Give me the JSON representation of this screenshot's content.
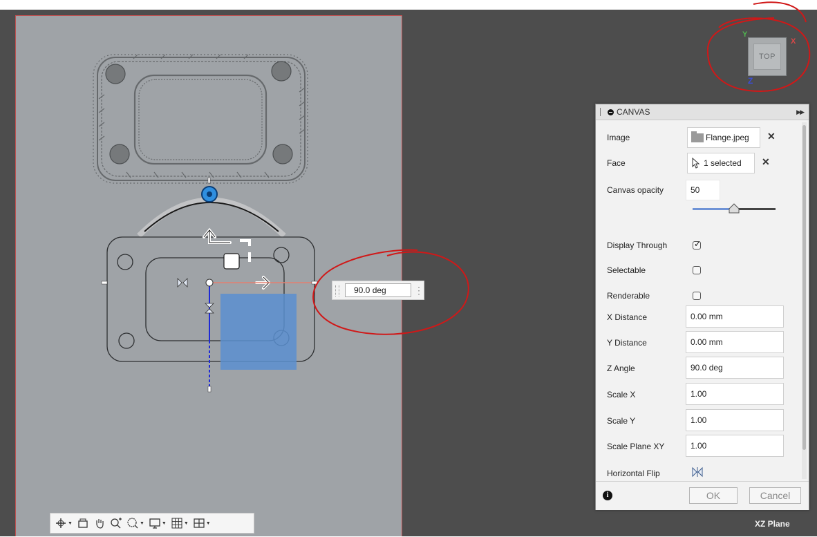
{
  "viewcube": {
    "face_label": "TOP",
    "axis_y": "Y",
    "axis_x": "X",
    "axis_z": "Z"
  },
  "angle_input": {
    "value": "90.0 deg"
  },
  "panel": {
    "title": "CANVAS",
    "image": {
      "label": "Image",
      "value": "Flange.jpeg"
    },
    "face": {
      "label": "Face",
      "value": "1 selected"
    },
    "opacity": {
      "label": "Canvas opacity",
      "value": "50",
      "slider_fraction": 0.5
    },
    "display_through": {
      "label": "Display Through",
      "checked": true
    },
    "selectable": {
      "label": "Selectable",
      "checked": false
    },
    "renderable": {
      "label": "Renderable",
      "checked": false
    },
    "x_distance": {
      "label": "X Distance",
      "value": "0.00 mm"
    },
    "y_distance": {
      "label": "Y Distance",
      "value": "0.00 mm"
    },
    "z_angle": {
      "label": "Z Angle",
      "value": "90.0 deg"
    },
    "scale_x": {
      "label": "Scale X",
      "value": "1.00"
    },
    "scale_y": {
      "label": "Scale Y",
      "value": "1.00"
    },
    "scale_plane_xy": {
      "label": "Scale Plane XY",
      "value": "1.00"
    },
    "horizontal_flip": {
      "label": "Horizontal Flip"
    },
    "ok_label": "OK",
    "cancel_label": "Cancel"
  },
  "status": {
    "plane_label": "XZ Plane"
  },
  "toolbar": {
    "items": [
      "orbit-icon",
      "look-at-icon",
      "pan-icon",
      "zoom-icon",
      "zoom-window-icon",
      "display-settings-icon",
      "grid-settings-icon",
      "viewports-icon"
    ]
  },
  "colors": {
    "viewport_bg": "#4d4d4d",
    "sheet_bg": "#9fa3a7",
    "annotation": "#d01818",
    "manipulator_blue": "#2f8fe0",
    "selection_blue": "#5b8fd0"
  }
}
